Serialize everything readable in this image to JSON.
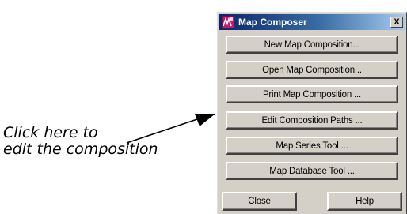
{
  "callout": {
    "line1": "Click here to",
    "line2": "edit the composition"
  },
  "window": {
    "title": "Map Composer",
    "close_glyph": "X",
    "buttons": [
      {
        "label": "New Map Composition..."
      },
      {
        "label": "Open Map Composition..."
      },
      {
        "label": "Print Map Composition ..."
      },
      {
        "label": "Edit Composition Paths ..."
      },
      {
        "label": "Map Series Tool ..."
      },
      {
        "label": "Map Database Tool ..."
      }
    ],
    "close_label": "Close",
    "help_label": "Help"
  },
  "colors": {
    "titlebar_start": "#0a246a",
    "titlebar_end": "#a6caf0",
    "face": "#d4d0c8",
    "icon_accent": "#b0185a"
  },
  "icons": {
    "app": "map-composer-app-icon",
    "close": "close-icon",
    "arrow": "callout-arrow"
  }
}
